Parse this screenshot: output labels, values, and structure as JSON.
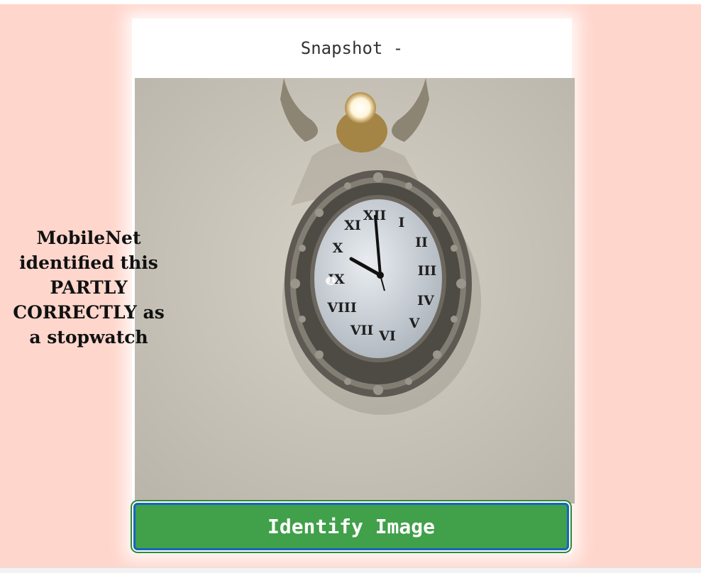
{
  "card": {
    "title": "Snapshot -"
  },
  "snapshot": {
    "icon": "wall-clock-photo",
    "clock_numerals": [
      "XII",
      "I",
      "II",
      "III",
      "IV",
      "V",
      "VI",
      "VII",
      "VIII",
      "IX",
      "X",
      "XI"
    ]
  },
  "result": {
    "text": "MobileNet identified this PARTLY CORRECTLY as a stopwatch"
  },
  "identify_button": {
    "label": "Identify Image"
  },
  "colors": {
    "page_background": "#ffd6cc",
    "button_background": "#41a04a",
    "button_outline": "#1565c0"
  }
}
